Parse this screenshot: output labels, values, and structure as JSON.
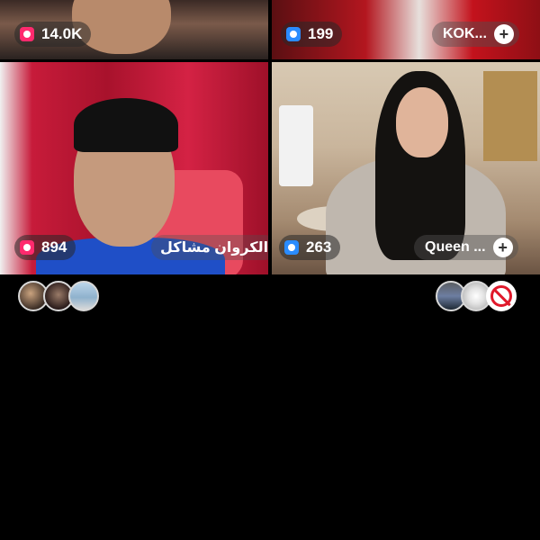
{
  "tiles": [
    {
      "id": "top-left",
      "viewer_count": "14.0K",
      "count_icon": "pink-live-icon"
    },
    {
      "id": "top-right",
      "viewer_count": "199",
      "count_icon": "blue-live-icon",
      "name": "KOK...",
      "action_icon": "plus-icon"
    },
    {
      "id": "bottom-left",
      "viewer_count": "894",
      "count_icon": "pink-live-icon",
      "name": "الكروان مشاكل"
    },
    {
      "id": "bottom-right",
      "viewer_count": "263",
      "count_icon": "blue-live-icon",
      "name": "Queen ...",
      "action_icon": "plus-icon"
    }
  ],
  "plus_symbol": "+",
  "left_avatars": [
    "avatar-1",
    "avatar-2",
    "avatar-3"
  ],
  "right_avatars": [
    "avatar-4",
    "avatar-5",
    "prohibited-icon"
  ],
  "colors": {
    "pink_icon": "#ff2a6e",
    "blue_icon": "#2a8cff",
    "background": "#000000"
  }
}
